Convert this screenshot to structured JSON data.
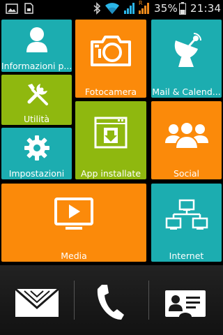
{
  "status_bar": {
    "battery_percent": "35%",
    "time": "21:34",
    "network_label": "R",
    "icons": [
      "gallery-notification-icon",
      "sd-card-icon",
      "bluetooth-icon",
      "wifi-icon",
      "signal-icon",
      "roaming-signal-icon",
      "battery-icon"
    ]
  },
  "tiles": {
    "informazioni": {
      "label": "Informazioni p...",
      "icon": "person-icon",
      "color": "#1cadb0"
    },
    "fotocamera": {
      "label": "Fotocamera",
      "icon": "camera-icon",
      "color": "#fb8a0a"
    },
    "mail": {
      "label": "Mail & Calend...",
      "icon": "satellite-dish-icon",
      "color": "#1cadb0"
    },
    "utilita": {
      "label": "Utilità",
      "icon": "tools-icon",
      "color": "#8fb80f"
    },
    "app_installate": {
      "label": "App installate",
      "icon": "download-window-icon",
      "color": "#8fb80f"
    },
    "social": {
      "label": "Social",
      "icon": "people-group-icon",
      "color": "#fb8a0a"
    },
    "impostazioni": {
      "label": "Impostazioni",
      "icon": "gear-icon",
      "color": "#1cadb0"
    },
    "media": {
      "label": "Media",
      "icon": "play-monitor-icon",
      "color": "#fb8a0a"
    },
    "internet": {
      "label": "Internet",
      "icon": "network-icon",
      "color": "#1cadb0"
    }
  },
  "dock": {
    "icons": [
      "envelope-icon",
      "phone-icon",
      "contact-card-icon"
    ]
  }
}
